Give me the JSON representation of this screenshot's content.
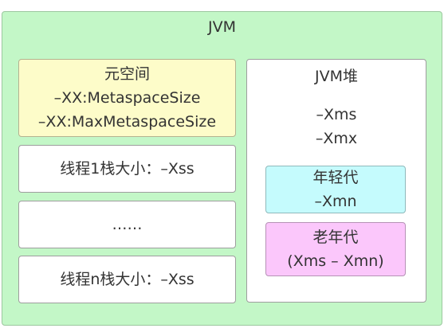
{
  "jvm": {
    "title": "JVM"
  },
  "metaspace": {
    "title": "元空间",
    "param1": "–XX:MetaspaceSize",
    "param2": "–XX:MaxMetaspaceSize"
  },
  "stacks": {
    "thread1": "线程1栈大小：–Xss",
    "ellipsis": "……",
    "threadn": "线程n栈大小：–Xss"
  },
  "heap": {
    "title": "JVM堆",
    "xms": "–Xms",
    "xmx": "–Xmx",
    "young": {
      "title": "年轻代",
      "param": "–Xmn"
    },
    "old": {
      "title": "老年代",
      "param": "(Xms – Xmn)"
    }
  },
  "colors": {
    "jvm_bg": "#c3f7c7",
    "metaspace_bg": "#fdfcc9",
    "young_bg": "#c5fbfd",
    "old_bg": "#fbc7fb"
  }
}
